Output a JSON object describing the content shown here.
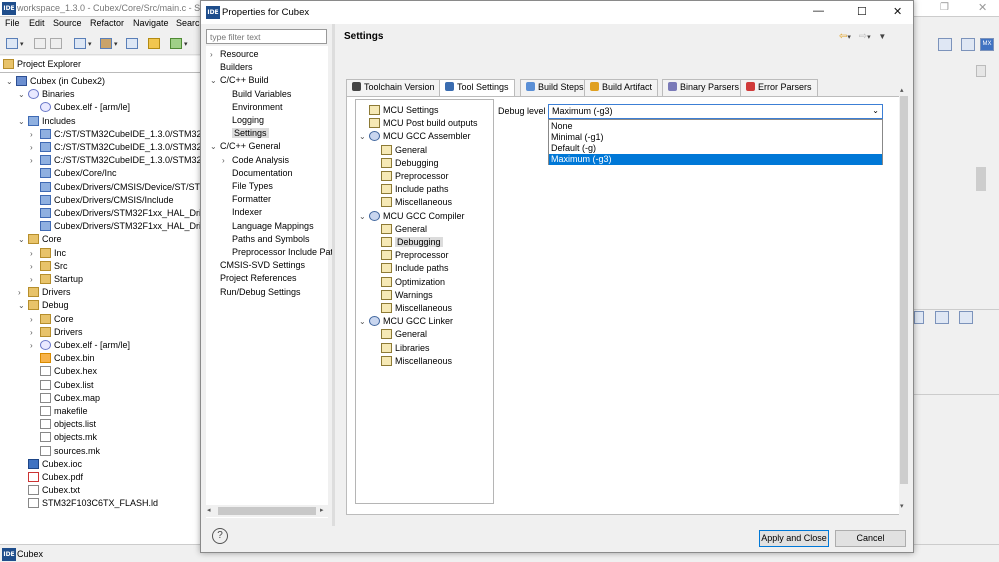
{
  "main_window": {
    "title": "workspace_1.3.0 - Cubex/Core/Src/main.c - STM",
    "menu": [
      "File",
      "Edit",
      "Source",
      "Refactor",
      "Navigate",
      "Search"
    ]
  },
  "explorer": {
    "tab_label": "Project Explorer",
    "items": [
      {
        "label": "Cubex (in Cubex2)",
        "icon": "project-icon",
        "depth": 0,
        "arrow": "v"
      },
      {
        "label": "Binaries",
        "icon": "binaries-icon",
        "depth": 1,
        "arrow": "v"
      },
      {
        "label": "Cubex.elf - [arm/le]",
        "icon": "elf-icon",
        "depth": 2,
        "arrow": ""
      },
      {
        "label": "Includes",
        "icon": "includes-icon",
        "depth": 1,
        "arrow": "v"
      },
      {
        "label": "C:/ST/STM32CubeIDE_1.3.0/STM32Cu",
        "icon": "include-folder-icon",
        "depth": 2,
        "arrow": ">"
      },
      {
        "label": "C:/ST/STM32CubeIDE_1.3.0/STM32Cu",
        "icon": "include-folder-icon",
        "depth": 2,
        "arrow": ">"
      },
      {
        "label": "C:/ST/STM32CubeIDE_1.3.0/STM32Cu",
        "icon": "include-folder-icon",
        "depth": 2,
        "arrow": ">"
      },
      {
        "label": "Cubex/Core/Inc",
        "icon": "include-folder-icon",
        "depth": 2,
        "arrow": ""
      },
      {
        "label": "Cubex/Drivers/CMSIS/Device/ST/STM",
        "icon": "include-folder-icon",
        "depth": 2,
        "arrow": ""
      },
      {
        "label": "Cubex/Drivers/CMSIS/Include",
        "icon": "include-folder-icon",
        "depth": 2,
        "arrow": ""
      },
      {
        "label": "Cubex/Drivers/STM32F1xx_HAL_Drive",
        "icon": "include-folder-icon",
        "depth": 2,
        "arrow": ""
      },
      {
        "label": "Cubex/Drivers/STM32F1xx_HAL_Drive",
        "icon": "include-folder-icon",
        "depth": 2,
        "arrow": ""
      },
      {
        "label": "Core",
        "icon": "folder-icon",
        "depth": 1,
        "arrow": "v"
      },
      {
        "label": "Inc",
        "icon": "folder-icon",
        "depth": 2,
        "arrow": ">"
      },
      {
        "label": "Src",
        "icon": "folder-icon",
        "depth": 2,
        "arrow": ">"
      },
      {
        "label": "Startup",
        "icon": "folder-icon",
        "depth": 2,
        "arrow": ">"
      },
      {
        "label": "Drivers",
        "icon": "folder-icon",
        "depth": 1,
        "arrow": ">"
      },
      {
        "label": "Debug",
        "icon": "folder-icon",
        "depth": 1,
        "arrow": "v"
      },
      {
        "label": "Core",
        "icon": "folder-icon",
        "depth": 2,
        "arrow": ">"
      },
      {
        "label": "Drivers",
        "icon": "folder-icon",
        "depth": 2,
        "arrow": ">"
      },
      {
        "label": "Cubex.elf - [arm/le]",
        "icon": "elf-icon",
        "depth": 2,
        "arrow": ">"
      },
      {
        "label": "Cubex.bin",
        "icon": "bin-file-icon",
        "depth": 2,
        "arrow": ""
      },
      {
        "label": "Cubex.hex",
        "icon": "file-icon",
        "depth": 2,
        "arrow": ""
      },
      {
        "label": "Cubex.list",
        "icon": "file-icon",
        "depth": 2,
        "arrow": ""
      },
      {
        "label": "Cubex.map",
        "icon": "file-icon",
        "depth": 2,
        "arrow": ""
      },
      {
        "label": "makefile",
        "icon": "file-icon",
        "depth": 2,
        "arrow": ""
      },
      {
        "label": "objects.list",
        "icon": "file-icon",
        "depth": 2,
        "arrow": ""
      },
      {
        "label": "objects.mk",
        "icon": "file-icon",
        "depth": 2,
        "arrow": ""
      },
      {
        "label": "sources.mk",
        "icon": "file-icon",
        "depth": 2,
        "arrow": ""
      },
      {
        "label": "Cubex.ioc",
        "icon": "mx-file-icon",
        "depth": 1,
        "arrow": ""
      },
      {
        "label": "Cubex.pdf",
        "icon": "pdf-file-icon",
        "depth": 1,
        "arrow": ""
      },
      {
        "label": "Cubex.txt",
        "icon": "file-icon",
        "depth": 1,
        "arrow": ""
      },
      {
        "label": "STM32F103C6TX_FLASH.ld",
        "icon": "file-icon",
        "depth": 1,
        "arrow": ""
      }
    ]
  },
  "status_bar": {
    "label": "Cubex"
  },
  "dialog": {
    "title": "Properties for Cubex",
    "filter_placeholder": "type filter text",
    "categories": [
      {
        "label": "Resource",
        "depth": 0,
        "arrow": ">"
      },
      {
        "label": "Builders",
        "depth": 0,
        "arrow": ""
      },
      {
        "label": "C/C++ Build",
        "depth": 0,
        "arrow": "v"
      },
      {
        "label": "Build Variables",
        "depth": 1,
        "arrow": ""
      },
      {
        "label": "Environment",
        "depth": 1,
        "arrow": ""
      },
      {
        "label": "Logging",
        "depth": 1,
        "arrow": ""
      },
      {
        "label": "Settings",
        "depth": 1,
        "arrow": "",
        "selected": true
      },
      {
        "label": "C/C++ General",
        "depth": 0,
        "arrow": "v"
      },
      {
        "label": "Code Analysis",
        "depth": 1,
        "arrow": ">"
      },
      {
        "label": "Documentation",
        "depth": 1,
        "arrow": ""
      },
      {
        "label": "File Types",
        "depth": 1,
        "arrow": ""
      },
      {
        "label": "Formatter",
        "depth": 1,
        "arrow": ""
      },
      {
        "label": "Indexer",
        "depth": 1,
        "arrow": ""
      },
      {
        "label": "Language Mappings",
        "depth": 1,
        "arrow": ""
      },
      {
        "label": "Paths and Symbols",
        "depth": 1,
        "arrow": ""
      },
      {
        "label": "Preprocessor Include Pat",
        "depth": 1,
        "arrow": ""
      },
      {
        "label": "CMSIS-SVD Settings",
        "depth": 0,
        "arrow": ""
      },
      {
        "label": "Project References",
        "depth": 0,
        "arrow": ""
      },
      {
        "label": "Run/Debug Settings",
        "depth": 0,
        "arrow": ""
      }
    ],
    "page_title": "Settings",
    "tabs": [
      {
        "label": "Toolchain Version",
        "icon": "toolchain-icon",
        "color": "#444444"
      },
      {
        "label": "Tool Settings",
        "icon": "tool-settings-icon",
        "color": "#3a6cb0",
        "active": true
      },
      {
        "label": "Build Steps",
        "icon": "build-steps-icon",
        "color": "#5a8fd6"
      },
      {
        "label": "Build Artifact",
        "icon": "build-artifact-icon",
        "color": "#e0a020"
      },
      {
        "label": "Binary Parsers",
        "icon": "binary-parsers-icon",
        "color": "#7a7ab8"
      },
      {
        "label": "Error Parsers",
        "icon": "error-parsers-icon",
        "color": "#d03a3a"
      }
    ],
    "tool_tree": [
      {
        "label": "MCU Settings",
        "depth": 0,
        "arrow": "",
        "icon": "tool-icon"
      },
      {
        "label": "MCU Post build outputs",
        "depth": 0,
        "arrow": "",
        "icon": "tool-icon"
      },
      {
        "label": "MCU GCC Assembler",
        "depth": 0,
        "arrow": "v",
        "icon": "tool-group-icon"
      },
      {
        "label": "General",
        "depth": 1,
        "arrow": "",
        "icon": "tool-icon"
      },
      {
        "label": "Debugging",
        "depth": 1,
        "arrow": "",
        "icon": "tool-icon"
      },
      {
        "label": "Preprocessor",
        "depth": 1,
        "arrow": "",
        "icon": "tool-icon"
      },
      {
        "label": "Include paths",
        "depth": 1,
        "arrow": "",
        "icon": "tool-icon"
      },
      {
        "label": "Miscellaneous",
        "depth": 1,
        "arrow": "",
        "icon": "tool-icon"
      },
      {
        "label": "MCU GCC Compiler",
        "depth": 0,
        "arrow": "v",
        "icon": "tool-group-icon"
      },
      {
        "label": "General",
        "depth": 1,
        "arrow": "",
        "icon": "tool-icon"
      },
      {
        "label": "Debugging",
        "depth": 1,
        "arrow": "",
        "icon": "tool-icon",
        "selected": true
      },
      {
        "label": "Preprocessor",
        "depth": 1,
        "arrow": "",
        "icon": "tool-icon"
      },
      {
        "label": "Include paths",
        "depth": 1,
        "arrow": "",
        "icon": "tool-icon"
      },
      {
        "label": "Optimization",
        "depth": 1,
        "arrow": "",
        "icon": "tool-icon"
      },
      {
        "label": "Warnings",
        "depth": 1,
        "arrow": "",
        "icon": "tool-icon"
      },
      {
        "label": "Miscellaneous",
        "depth": 1,
        "arrow": "",
        "icon": "tool-icon"
      },
      {
        "label": "MCU GCC Linker",
        "depth": 0,
        "arrow": "v",
        "icon": "tool-group-icon"
      },
      {
        "label": "General",
        "depth": 1,
        "arrow": "",
        "icon": "tool-icon"
      },
      {
        "label": "Libraries",
        "depth": 1,
        "arrow": "",
        "icon": "tool-icon"
      },
      {
        "label": "Miscellaneous",
        "depth": 1,
        "arrow": "",
        "icon": "tool-icon"
      }
    ],
    "debug_level": {
      "label": "Debug level",
      "value": "Maximum (-g3)",
      "options": [
        "None",
        "Minimal (-g1)",
        "Default (-g)",
        "Maximum (-g3)"
      ],
      "selected_index": 3
    },
    "buttons": {
      "apply_close": "Apply and Close",
      "cancel": "Cancel",
      "help": "?"
    }
  },
  "colors": {
    "accent": "#0078d7",
    "ide_badge": "#1f4e8c"
  }
}
